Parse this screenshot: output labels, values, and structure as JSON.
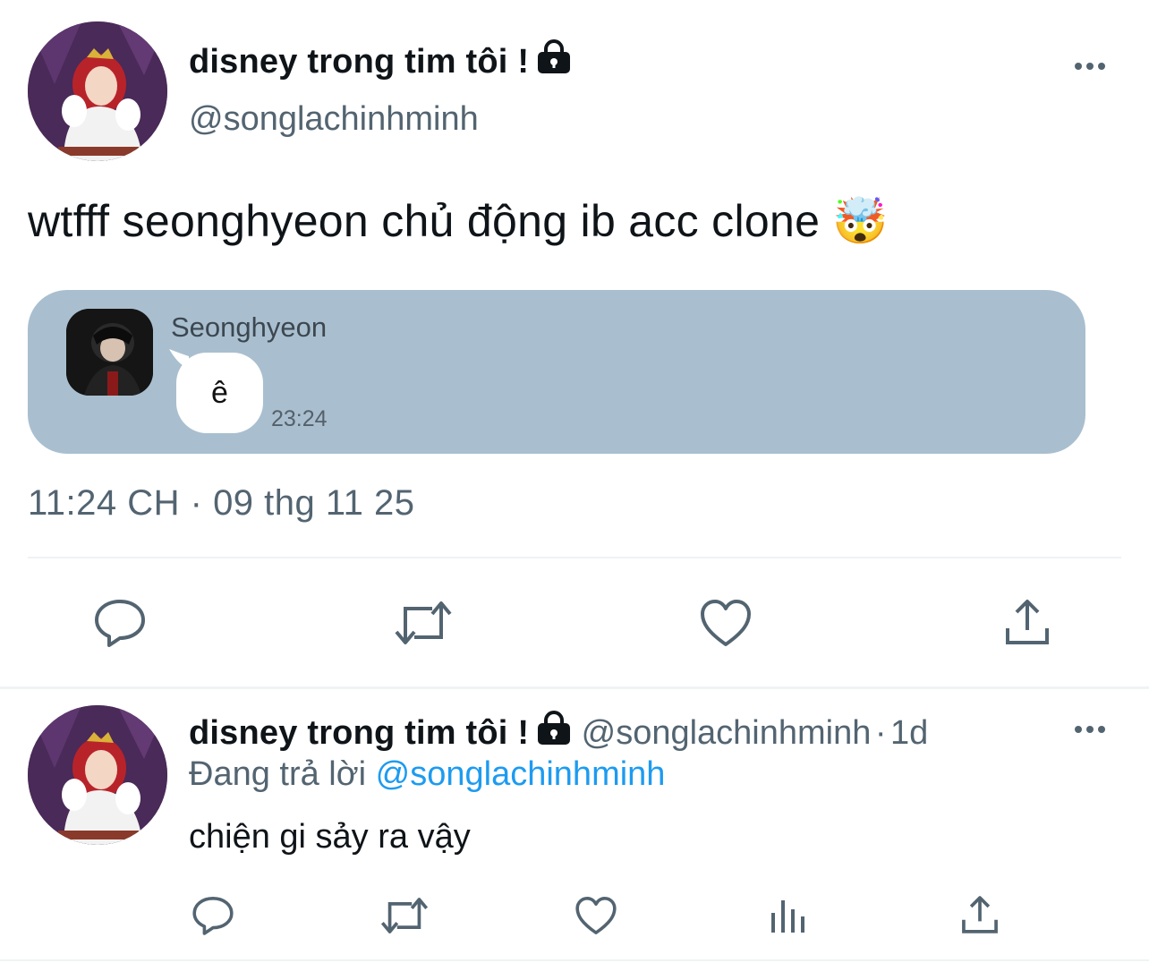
{
  "main_tweet": {
    "display_name": "disney trong tim tôi !",
    "handle": "@songlachinhminh",
    "text": "wtfff seonghyeon chủ động ib acc clone",
    "emoji": "🤯",
    "attachment": {
      "sender_name": "Seonghyeon",
      "message": "ê",
      "time": "23:24"
    },
    "timestamp": "11:24 CH · 09 thg 11 25",
    "actions": [
      "reply-icon",
      "retweet-icon",
      "like-icon",
      "share-icon"
    ]
  },
  "reply": {
    "display_name": "disney trong tim tôi !",
    "handle": "@songlachinhminh",
    "separator": "·",
    "age": "1d",
    "replying_label": "Đang trả lời",
    "replying_to": "@songlachinhminh",
    "text": "chiện gi sảy ra vậy",
    "actions": [
      "reply-icon",
      "retweet-icon",
      "like-icon",
      "analytics-icon",
      "share-icon"
    ]
  },
  "colors": {
    "text": "#0f1419",
    "secondary": "#536471",
    "link": "#1d9bf0",
    "attachment_bg": "#a9bfcf",
    "divider": "#eff3f4"
  }
}
